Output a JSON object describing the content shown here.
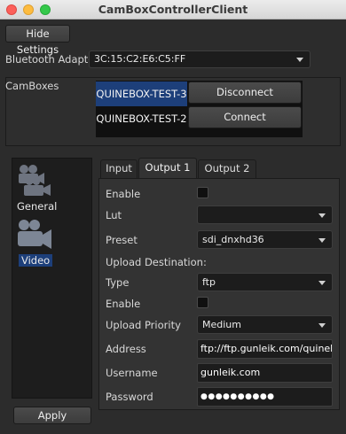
{
  "window": {
    "title": "CamBoxControllerClient"
  },
  "settings": {
    "hide_button_label": "Hide Settings"
  },
  "bluetooth": {
    "label": "Bluetooth Adapter",
    "value": "3C:15:C2:E6:C5:FF"
  },
  "camboxes": {
    "label": "CamBoxes",
    "items": [
      {
        "name": "QUINEBOX-TEST-3",
        "action": "Disconnect",
        "selected": true
      },
      {
        "name": "QUINEBOX-TEST-2",
        "action": "Connect",
        "selected": false
      }
    ]
  },
  "sidebar": {
    "items": [
      {
        "label": "General",
        "icon": "camera-icon",
        "selected": false
      },
      {
        "label": "Video",
        "icon": "video-camera-icon",
        "selected": true
      }
    ],
    "apply_label": "Apply"
  },
  "tabs": [
    "Input",
    "Output 1",
    "Output 2"
  ],
  "active_tab": "Output 1",
  "form": {
    "enable_label": "Enable",
    "lut_label": "Lut",
    "lut_value": "",
    "preset_label": "Preset",
    "preset_value": "sdi_dnxhd36",
    "upload_destination_label": "Upload Destination:",
    "type_label": "Type",
    "type_value": "ftp",
    "upload_enable_label": "Enable",
    "upload_priority_label": "Upload Priority",
    "upload_priority_value": "Medium",
    "address_label": "Address",
    "address_value": "ftp://ftp.gunleik.com/quinebox",
    "username_label": "Username",
    "username_value": "gunleik.com",
    "password_label": "Password",
    "password_value": "●●●●●●●●●●"
  },
  "colors": {
    "selection": "#1d3f7a",
    "background": "#2c2c2c",
    "field": "#1c1c1c"
  }
}
